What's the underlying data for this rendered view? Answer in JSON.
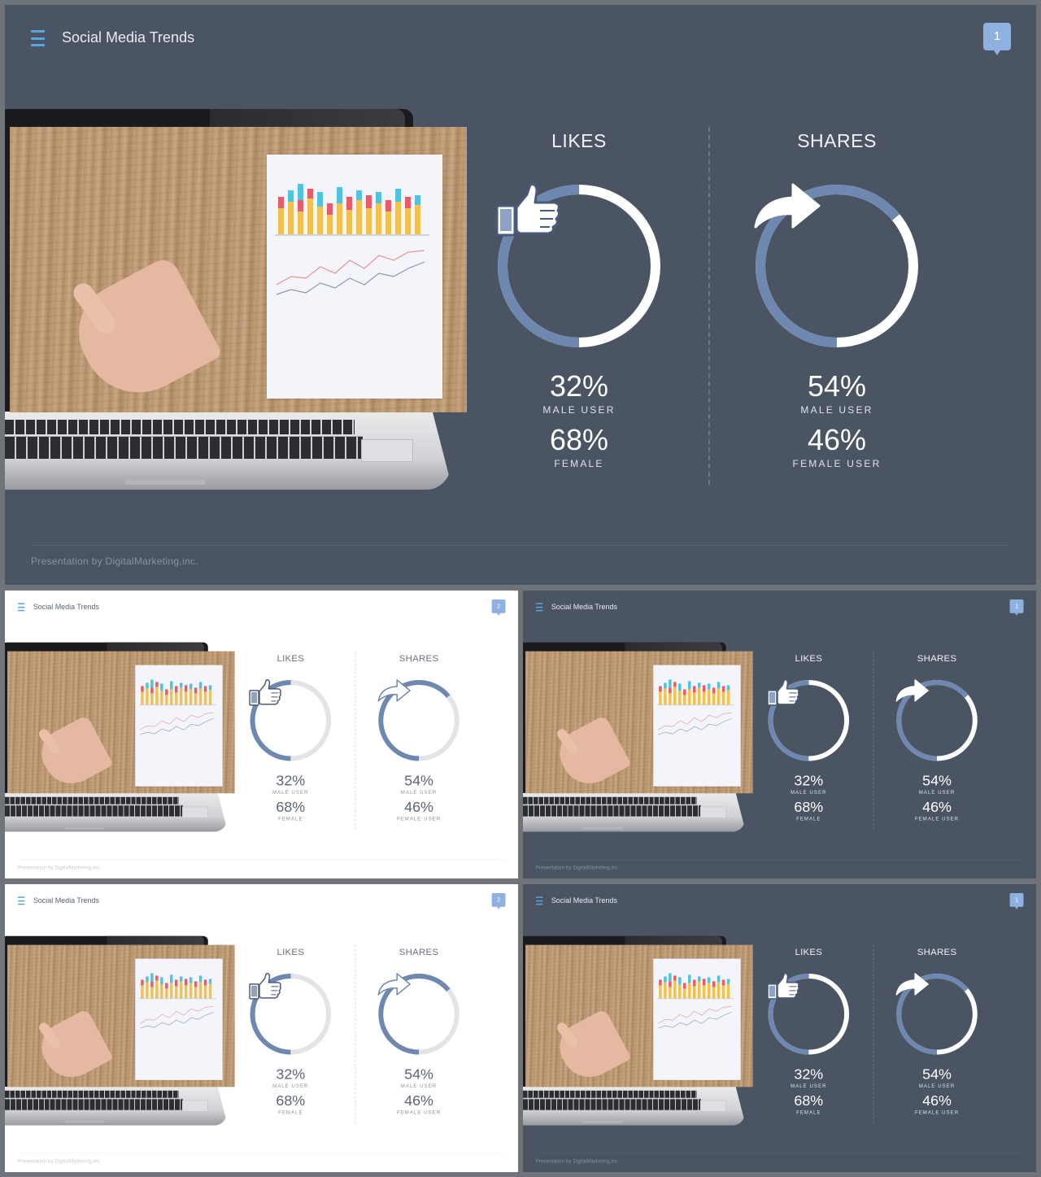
{
  "deck": {
    "title": "Social Media Trends",
    "footer": "Presentation  by DigitalMarketing,inc."
  },
  "likes": {
    "heading": "LIKES",
    "male_pct": "32%",
    "male_label": "MALE USER",
    "female_pct": "68%",
    "female_label": "FEMALE",
    "ring_fraction": 0.32,
    "icon": "thumbs-up-icon"
  },
  "shares": {
    "heading": "SHARES",
    "male_pct": "54%",
    "male_label": "MALE USER",
    "female_pct": "46%",
    "female_label": "FEMALE USER",
    "ring_fraction": 0.46,
    "icon": "share-arrow-icon"
  },
  "slides": [
    {
      "theme": "dark",
      "page": "1"
    },
    {
      "theme": "light",
      "page": "2"
    },
    {
      "theme": "dark",
      "page": "1"
    },
    {
      "theme": "light",
      "page": "2"
    },
    {
      "theme": "dark",
      "page": "1"
    }
  ],
  "colors": {
    "dark_bg": "#4a5462",
    "light_bg": "#ffffff",
    "ring_accent": "#6f88b0",
    "ring_light_track": "#e2e4e8",
    "badge": "#8fb1e0",
    "menu_icon": "#5aa4e0"
  }
}
